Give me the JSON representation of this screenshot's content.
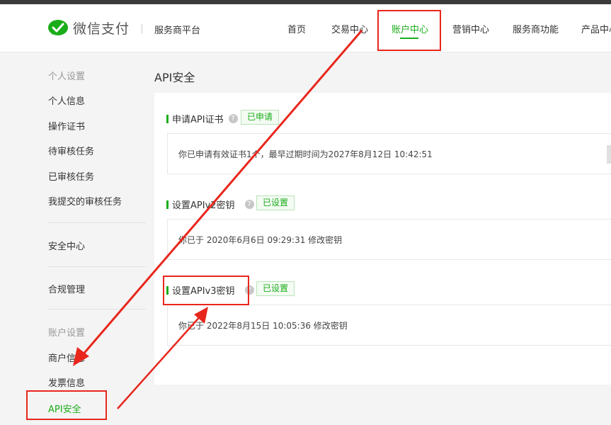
{
  "header": {
    "brand": "微信支付",
    "platform": "服务商平台",
    "nav": [
      "首页",
      "交易中心",
      "账户中心",
      "营销中心",
      "服务商功能",
      "产品中心"
    ],
    "active_nav": "账户中心"
  },
  "sidebar": {
    "group_personal": "个人设置",
    "personal_items": [
      "个人信息",
      "操作证书",
      "待审核任务",
      "已审核任务",
      "我提交的审核任务"
    ],
    "security": "安全中心",
    "compliance": "合规管理",
    "group_account": "账户设置",
    "account_items": [
      "商户信息",
      "发票信息",
      "API安全"
    ],
    "active_item": "API安全"
  },
  "main": {
    "title": "API安全",
    "sections": [
      {
        "title": "申请API证书",
        "badge": "已申请",
        "info": "你已申请有效证书1个，最早过期时间为2027年8月12日 10:42:51"
      },
      {
        "title": "设置APIv2密钥",
        "badge": "已设置",
        "info": "你已于 2020年6月6日 09:29:31 修改密钥"
      },
      {
        "title": "设置APIv3密钥",
        "badge": "已设置",
        "info": "你已于 2022年8月15日 10:05:36 修改密钥"
      }
    ]
  },
  "colors": {
    "accent": "#1aad19",
    "annotation": "#e8261c"
  },
  "icons": {
    "logo": "wechat-pay-logo",
    "help": "question-mark-icon"
  }
}
